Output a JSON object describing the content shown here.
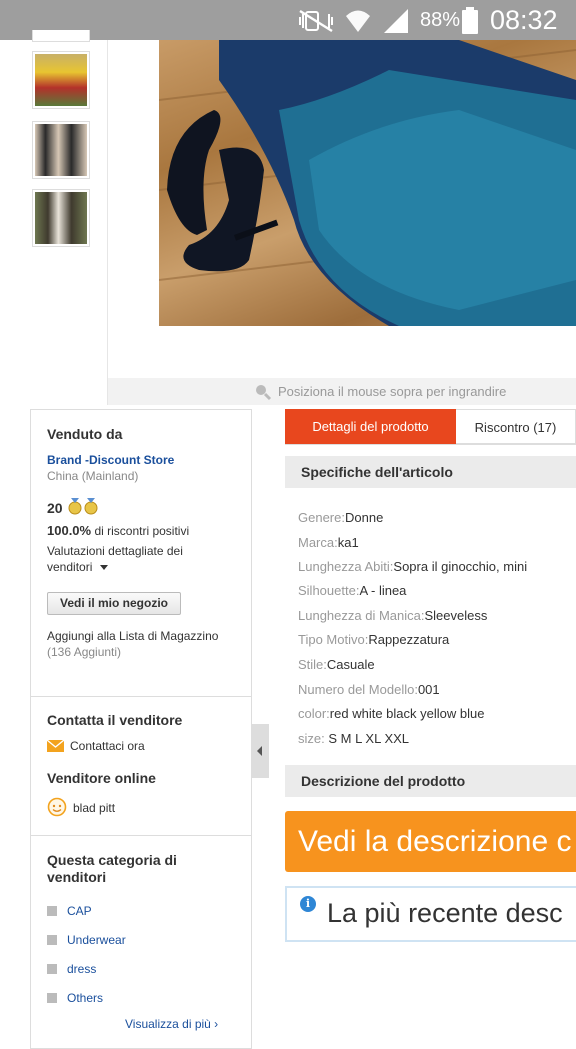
{
  "status_bar": {
    "battery_percent": "88%",
    "time": "08:32",
    "icons": [
      "mute-vibrate-icon",
      "wifi-icon",
      "signal-icon",
      "battery-icon"
    ]
  },
  "gallery": {
    "thumbnails": [
      {
        "name": "thumbnail-1",
        "colors": [
          "#e8c531",
          "#b3312a",
          "#5a7a3a"
        ]
      },
      {
        "name": "thumbnail-2",
        "colors": [
          "#2a2a2a",
          "#d6c7b5",
          "#3a3a3a"
        ]
      },
      {
        "name": "thumbnail-3",
        "colors": [
          "#3f3a2e",
          "#e9e4da",
          "#6e7750"
        ]
      }
    ],
    "main_image_alt": "dress",
    "zoom_hint": "Posiziona il mouse sopra per ingrandire"
  },
  "seller": {
    "sold_by_label": "Venduto da",
    "store_name": "Brand -Discount Store",
    "location": "China (Mainland)",
    "score": "20",
    "positive_percent": "100.0%",
    "positive_label": "di riscontri positivi",
    "detailed_ratings": "Valutazioni dettagliate dei venditori",
    "visit_store_button": "Vedi il mio negozio",
    "add_wishlist": "Aggiungi alla Lista di Magazzino",
    "added_count": "(136 Aggiunti)",
    "contact_heading": "Contatta il venditore",
    "contact_now": "Contattaci ora",
    "online_heading": "Venditore online",
    "online_name": "blad pitt",
    "category_heading": "Questa categoria di venditori",
    "categories": [
      "CAP",
      "Underwear",
      "dress",
      "Others"
    ],
    "view_more": "Visualizza di più"
  },
  "tabs": {
    "product_details": "Dettagli del prodotto",
    "feedback": "Riscontro (17)"
  },
  "specs": {
    "heading": "Specifiche dell'articolo",
    "rows": [
      {
        "k": "Genere:",
        "v": "Donne"
      },
      {
        "k": "Marca:",
        "v": "ka1"
      },
      {
        "k": "Lunghezza Abiti:",
        "v": "Sopra il ginocchio, mini"
      },
      {
        "k": "Silhouette:",
        "v": "A - linea"
      },
      {
        "k": "Lunghezza di Manica:",
        "v": "Sleeveless"
      },
      {
        "k": "Tipo Motivo:",
        "v": "Rappezzatura"
      },
      {
        "k": "Stile:",
        "v": "Casuale"
      },
      {
        "k": "Numero del Modello:",
        "v": "001"
      },
      {
        "k": "color:",
        "v": "red white black yellow blue"
      },
      {
        "k": "size:",
        "v": " S M L XL XXL"
      }
    ]
  },
  "description": {
    "heading": "Descrizione del prodotto",
    "view_button": "Vedi la descrizione c",
    "latest_info": "La più recente desc"
  },
  "colors": {
    "accent_red": "#e8471e",
    "orange": "#f7931e",
    "link_blue": "#1a4f9c",
    "status_bar": "#9e9e9e"
  }
}
